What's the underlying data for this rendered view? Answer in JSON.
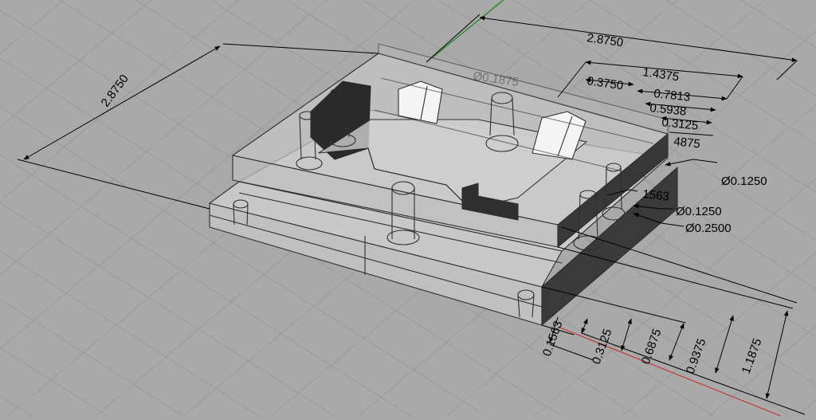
{
  "viewport": {
    "background": "#a9a9a9",
    "grid_color": "#9a9a9a",
    "x_axis_color": "#c23a3a",
    "y_axis_color": "#1d8a1d",
    "part_fill": "#c4c4c4",
    "edge_color": "#2e2e2e"
  },
  "dimensions": {
    "depth_left": "2.8750",
    "width_top": "2.8750",
    "half_width": "1.4375",
    "d_0_3750": "0.3750",
    "d_0_7813": "0.7813",
    "d_0_5938": "0.5938",
    "d_0_3125_top": "0.3125",
    "d_partial": "4875",
    "d_hidden": "Ø0.1875",
    "d_0_1563_right": "1563",
    "dia_1": "Ø0.1250",
    "dia_2": "Ø0.1250",
    "dia_3": "Ø0.2500",
    "h_0_1563": "0.1563",
    "h_0_3125": "0.3125",
    "h_0_6875": "0.6875",
    "h_0_9375": "0.9375",
    "h_1_1875": "1.1875"
  }
}
